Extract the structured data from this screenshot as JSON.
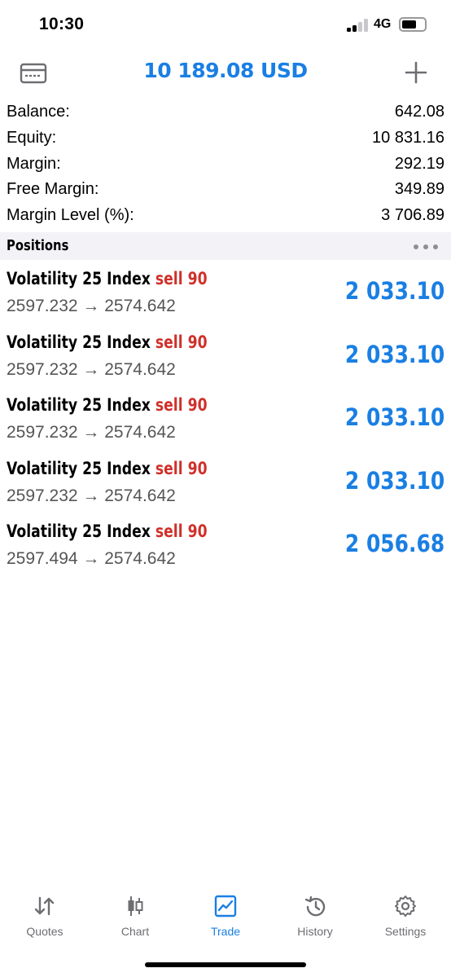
{
  "status": {
    "time": "10:30",
    "network": "4G"
  },
  "nav": {
    "title": "10 189.08 USD",
    "left_icon": "wallet-card-icon",
    "right_icon": "plus-icon"
  },
  "summary": [
    {
      "label": "Balance:",
      "value": "642.08"
    },
    {
      "label": "Equity:",
      "value": "10 831.16"
    },
    {
      "label": "Margin:",
      "value": "292.19"
    },
    {
      "label": "Free Margin:",
      "value": "349.89"
    },
    {
      "label": "Margin Level (%):",
      "value": "3 706.89"
    }
  ],
  "section": {
    "title": "Positions",
    "menu_icon": "more-dots-icon"
  },
  "positions": [
    {
      "symbol": "Volatility 25 Index",
      "type": "sell 90",
      "prices": "2597.232 → 2574.642",
      "profit": "2 033.10"
    },
    {
      "symbol": "Volatility 25 Index",
      "type": "sell 90",
      "prices": "2597.232 → 2574.642",
      "profit": "2 033.10"
    },
    {
      "symbol": "Volatility 25 Index",
      "type": "sell 90",
      "prices": "2597.232 → 2574.642",
      "profit": "2 033.10"
    },
    {
      "symbol": "Volatility 25 Index",
      "type": "sell 90",
      "prices": "2597.232 → 2574.642",
      "profit": "2 033.10"
    },
    {
      "symbol": "Volatility 25 Index",
      "type": "sell 90",
      "prices": "2597.494 → 2574.642",
      "profit": "2 056.68"
    }
  ],
  "tabs": [
    {
      "label": "Quotes",
      "icon": "sort-arrows-icon",
      "active": false
    },
    {
      "label": "Chart",
      "icon": "candlestick-icon",
      "active": false
    },
    {
      "label": "Trade",
      "icon": "trend-chart-icon",
      "active": true
    },
    {
      "label": "History",
      "icon": "history-clock-icon",
      "active": false
    },
    {
      "label": "Settings",
      "icon": "gear-icon",
      "active": false
    }
  ],
  "colors": {
    "accent": "#1a7fe3",
    "sell": "#d0302a",
    "secondary_text": "#555555",
    "section_bg": "#f2f2f7"
  }
}
